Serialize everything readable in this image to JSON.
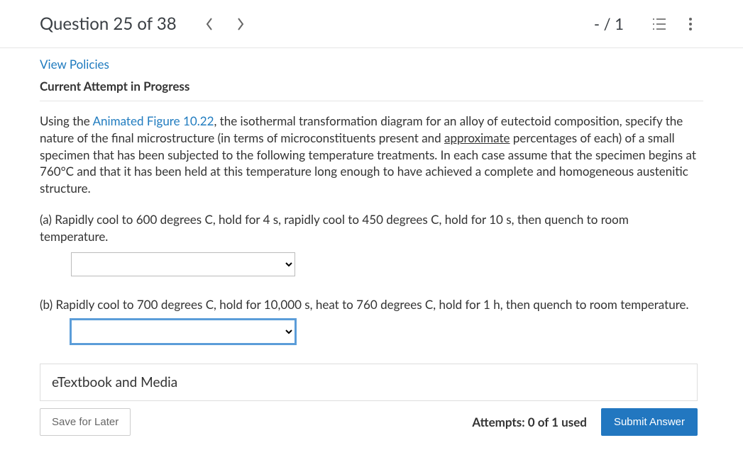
{
  "header": {
    "question_title": "Question 25 of 38",
    "score": "- / 1"
  },
  "policies_link": "View Policies",
  "attempt_status": "Current Attempt in Progress",
  "question": {
    "intro_pre": "Using the ",
    "figure_link": "Animated Figure 10.22",
    "intro_mid": ", the isothermal transformation diagram for an alloy of eutectoid composition, specify the nature of the final microstructure (in terms of microconstituents present and ",
    "approx_word": "approximate",
    "intro_post": " percentages of each) of a small specimen that has been subjected to the following temperature treatments. In each case assume that the specimen begins at 760°C and that it has been held at this temperature long enough to have achieved a complete and homogeneous austenitic structure.",
    "part_a": "(a) Rapidly cool to 600 degrees C, hold for 4 s, rapidly cool to 450 degrees C, hold for 10 s, then quench to room temperature.",
    "part_b": "(b) Rapidly cool to 700 degrees C, hold for 10,000 s, heat to 760 degrees C, hold for 1 h, then quench to room temperature."
  },
  "etextbook_label": "eTextbook and Media",
  "footer": {
    "save_label": "Save for Later",
    "attempts": "Attempts: 0 of 1 used",
    "submit_label": "Submit Answer"
  }
}
